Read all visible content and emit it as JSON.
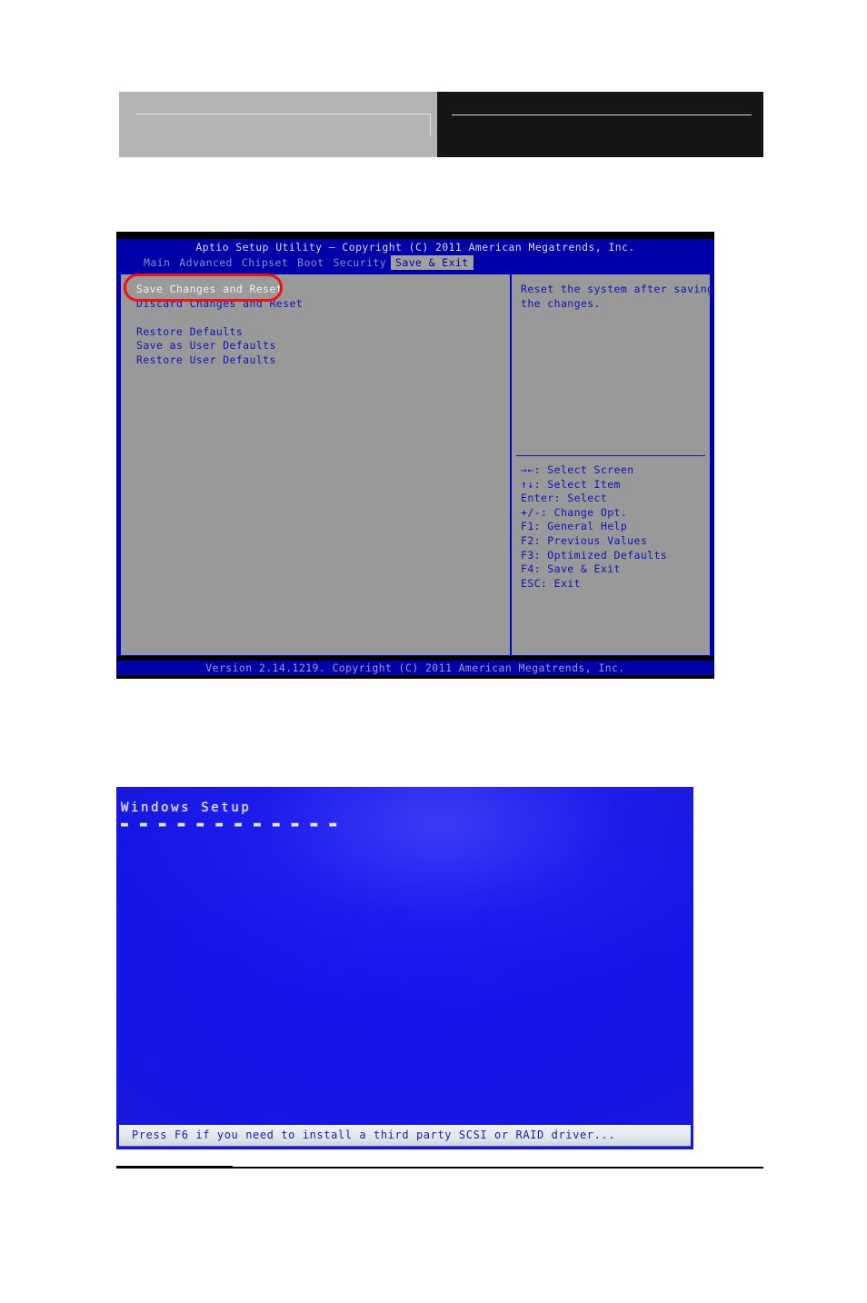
{
  "header": {
    "left_block_label": "",
    "right_block_label": ""
  },
  "bios": {
    "title": "Aptio Setup Utility – Copyright (C) 2011 American Megatrends, Inc.",
    "tabs": [
      {
        "label": "Main",
        "active": false
      },
      {
        "label": "Advanced",
        "active": false
      },
      {
        "label": "Chipset",
        "active": false
      },
      {
        "label": "Boot",
        "active": false
      },
      {
        "label": "Security",
        "active": false
      },
      {
        "label": "Save & Exit",
        "active": true
      }
    ],
    "menu_items": [
      {
        "label": "Save Changes and Reset",
        "selected": true,
        "spacer_after": false
      },
      {
        "label": "Discard Changes and Reset",
        "selected": false,
        "spacer_after": true
      },
      {
        "label": "Restore Defaults",
        "selected": false,
        "spacer_after": false
      },
      {
        "label": "Save as User Defaults",
        "selected": false,
        "spacer_after": false
      },
      {
        "label": "Restore User Defaults",
        "selected": false,
        "spacer_after": false
      }
    ],
    "help_lines": [
      "Reset the system after saving",
      "the changes."
    ],
    "key_legend": [
      "→←: Select Screen",
      "↑↓: Select Item",
      "Enter: Select",
      "+/-: Change Opt.",
      "F1: General Help",
      "F2: Previous Values",
      "F3: Optimized Defaults",
      "F4: Save & Exit",
      "ESC: Exit"
    ],
    "footer": "Version 2.14.1219. Copyright (C) 2011 American Megatrends, Inc.",
    "colors": {
      "screen_blue": "#0000a8",
      "panel_gray": "#999999",
      "menu_text": "#1414b4",
      "annotation_red": "#ee1111"
    }
  },
  "annotation": {
    "shape": "ellipse-highlight",
    "target_label": "Save Changes and Reset"
  },
  "windows_setup": {
    "title": "Windows Setup",
    "title_underline": "▬ ▬ ▬ ▬ ▬ ▬ ▬ ▬ ▬ ▬ ▬ ▬",
    "status_text": "Press F6 if you need to install a third party SCSI or RAID driver...",
    "colors": {
      "background_blue": "#1414f0",
      "status_text_blue": "#1a1ab4"
    }
  }
}
